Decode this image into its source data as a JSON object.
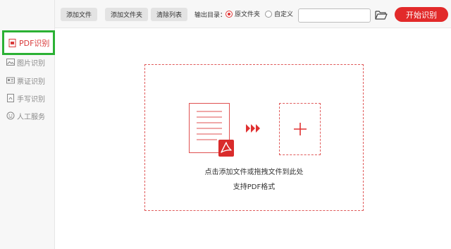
{
  "sidebar": {
    "items": [
      {
        "label": "PDF识别",
        "icon": "pdf-file-icon",
        "active": true
      },
      {
        "label": "图片识别",
        "icon": "image-icon",
        "active": false
      },
      {
        "label": "票证识别",
        "icon": "id-card-icon",
        "active": false
      },
      {
        "label": "手写识别",
        "icon": "handwriting-icon",
        "active": false
      },
      {
        "label": "人工服务",
        "icon": "smiley-icon",
        "active": false
      }
    ]
  },
  "toolbar": {
    "add_file": "添加文件",
    "add_folder": "添加文件夹",
    "clear_list": "清除列表",
    "output_label": "输出目录：",
    "radio_original": "原文件夹",
    "radio_custom": "自定义",
    "selected_output": "原文件夹",
    "path_value": "",
    "start": "开始识别"
  },
  "dropzone": {
    "hint_line1": "点击添加文件或拖拽文件到此处",
    "hint_line2": "支持PDF格式"
  },
  "colors": {
    "accent": "#e22a2a",
    "active_outline": "#2bb134",
    "dashed": "#e05a5a"
  }
}
